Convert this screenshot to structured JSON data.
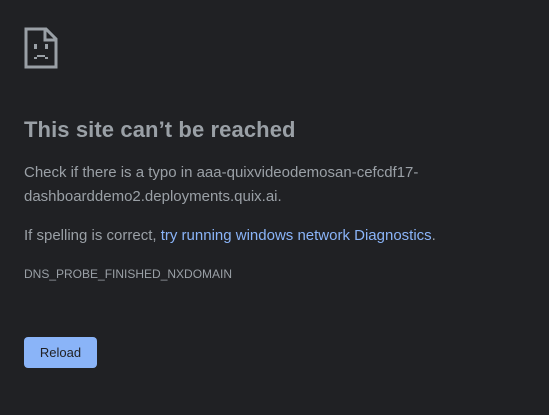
{
  "error": {
    "icon": "sad-page-icon",
    "title": "This site can’t be reached",
    "typo_prefix": "Check if there is a typo in ",
    "domain": "aaa-quixvideodemosan-cefcdf17-dashboarddemo2.deployments.quix.ai",
    "typo_suffix": ".",
    "spelling_prefix": "If spelling is correct, ",
    "diagnostics_link": "try running windows network Diagnostics",
    "spelling_suffix": ".",
    "code": "DNS_PROBE_FINISHED_NXDOMAIN"
  },
  "actions": {
    "reload_label": "Reload"
  },
  "colors": {
    "background": "#202124",
    "text": "#9aa0a6",
    "link": "#8ab4f8",
    "button": "#8ab4f8"
  }
}
